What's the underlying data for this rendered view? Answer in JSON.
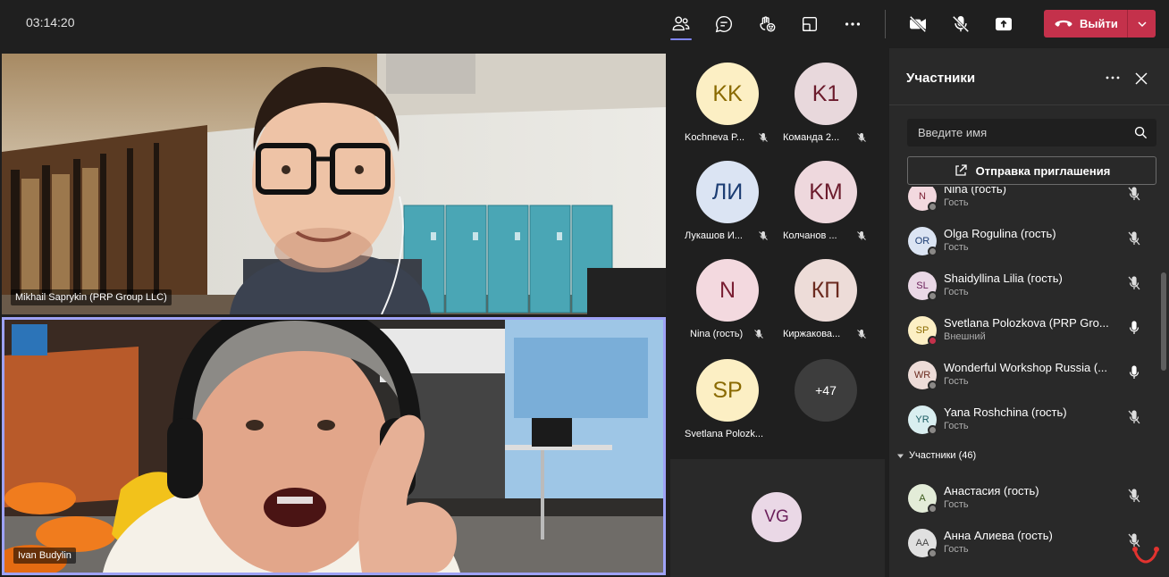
{
  "topbar": {
    "timer": "03:14:20",
    "leave_label": "Выйти",
    "icons": [
      "people-icon",
      "chat-icon",
      "reactions-icon",
      "view-icon",
      "more-icon",
      "camera-off-icon",
      "mic-off-icon",
      "share-icon"
    ],
    "accent": "#7f85f5",
    "leave_color": "#c4314b"
  },
  "videos": [
    {
      "name": "Mikhail Saprykin (PRP Group LLC)"
    },
    {
      "name": "Ivan Budylin"
    }
  ],
  "gallery": [
    {
      "initials": "KK",
      "name": "Kochneva P...",
      "bg": "#fcefc4",
      "fg": "#8a6a00"
    },
    {
      "initials": "K1",
      "name": "Команда 2...",
      "bg": "#e8d8dc",
      "fg": "#6b1b2c"
    },
    {
      "initials": "ЛИ",
      "name": "Лукашов И...",
      "bg": "#dbe4f3",
      "fg": "#1c3d73"
    },
    {
      "initials": "KM",
      "name": "Колчанов ...",
      "bg": "#eed8dd",
      "fg": "#6b1b2c"
    },
    {
      "initials": "N",
      "name": "Nina (гость)",
      "bg": "#f3d9df",
      "fg": "#7a1f33"
    },
    {
      "initials": "КП",
      "name": "Киржакова...",
      "bg": "#eddcd8",
      "fg": "#6b2a1f"
    },
    {
      "initials": "SP",
      "name": "Svetlana Polozk...",
      "bg": "#fcefc4",
      "fg": "#8a6a00"
    },
    {
      "initials": "+47",
      "name": "",
      "bg": "#3d3d3d",
      "fg": "#ffffff"
    }
  ],
  "gallery_extra": {
    "initials": "VG",
    "bg": "#ead8e6",
    "fg": "#6b1f5a"
  },
  "panel": {
    "title": "Участники",
    "search_placeholder": "Введите имя",
    "invite_label": "Отправка приглашения",
    "section_label": "Участники (46)",
    "people": [
      {
        "initials": "N",
        "name": "Nina (гость)",
        "role": "Гость",
        "bg": "#f3d9df",
        "fg": "#7a1f33",
        "mic": "off",
        "status": "away"
      },
      {
        "initials": "OR",
        "name": "Olga Rogulina (гость)",
        "role": "Гость",
        "bg": "#dbe4f3",
        "fg": "#1c3d73",
        "mic": "off",
        "status": "away"
      },
      {
        "initials": "SL",
        "name": "Shaidyllina Lilia (гость)",
        "role": "Гость",
        "bg": "#ead8e6",
        "fg": "#6b1f5a",
        "mic": "off",
        "status": "away"
      },
      {
        "initials": "SP",
        "name": "Svetlana Polozkova (PRP Gro...",
        "role": "Внешний",
        "bg": "#fcefc4",
        "fg": "#8a6a00",
        "mic": "on",
        "status": "busy"
      },
      {
        "initials": "WR",
        "name": "Wonderful Workshop Russia (...",
        "role": "Гость",
        "bg": "#eddcd8",
        "fg": "#6b2a1f",
        "mic": "on",
        "status": "away"
      },
      {
        "initials": "YR",
        "name": "Yana Roshchina (гость)",
        "role": "Гость",
        "bg": "#d9eef0",
        "fg": "#1b5c63",
        "mic": "off",
        "status": "away"
      }
    ],
    "people2": [
      {
        "initials": "A",
        "name": "Анастасия (гость)",
        "role": "Гость",
        "bg": "#e3ecd8",
        "fg": "#3b5a1b",
        "mic": "off",
        "status": "away"
      },
      {
        "initials": "AA",
        "name": "Анна Алиева (гость)",
        "role": "Гость",
        "bg": "#e0e0e0",
        "fg": "#444444",
        "mic": "off",
        "status": "away"
      }
    ]
  }
}
